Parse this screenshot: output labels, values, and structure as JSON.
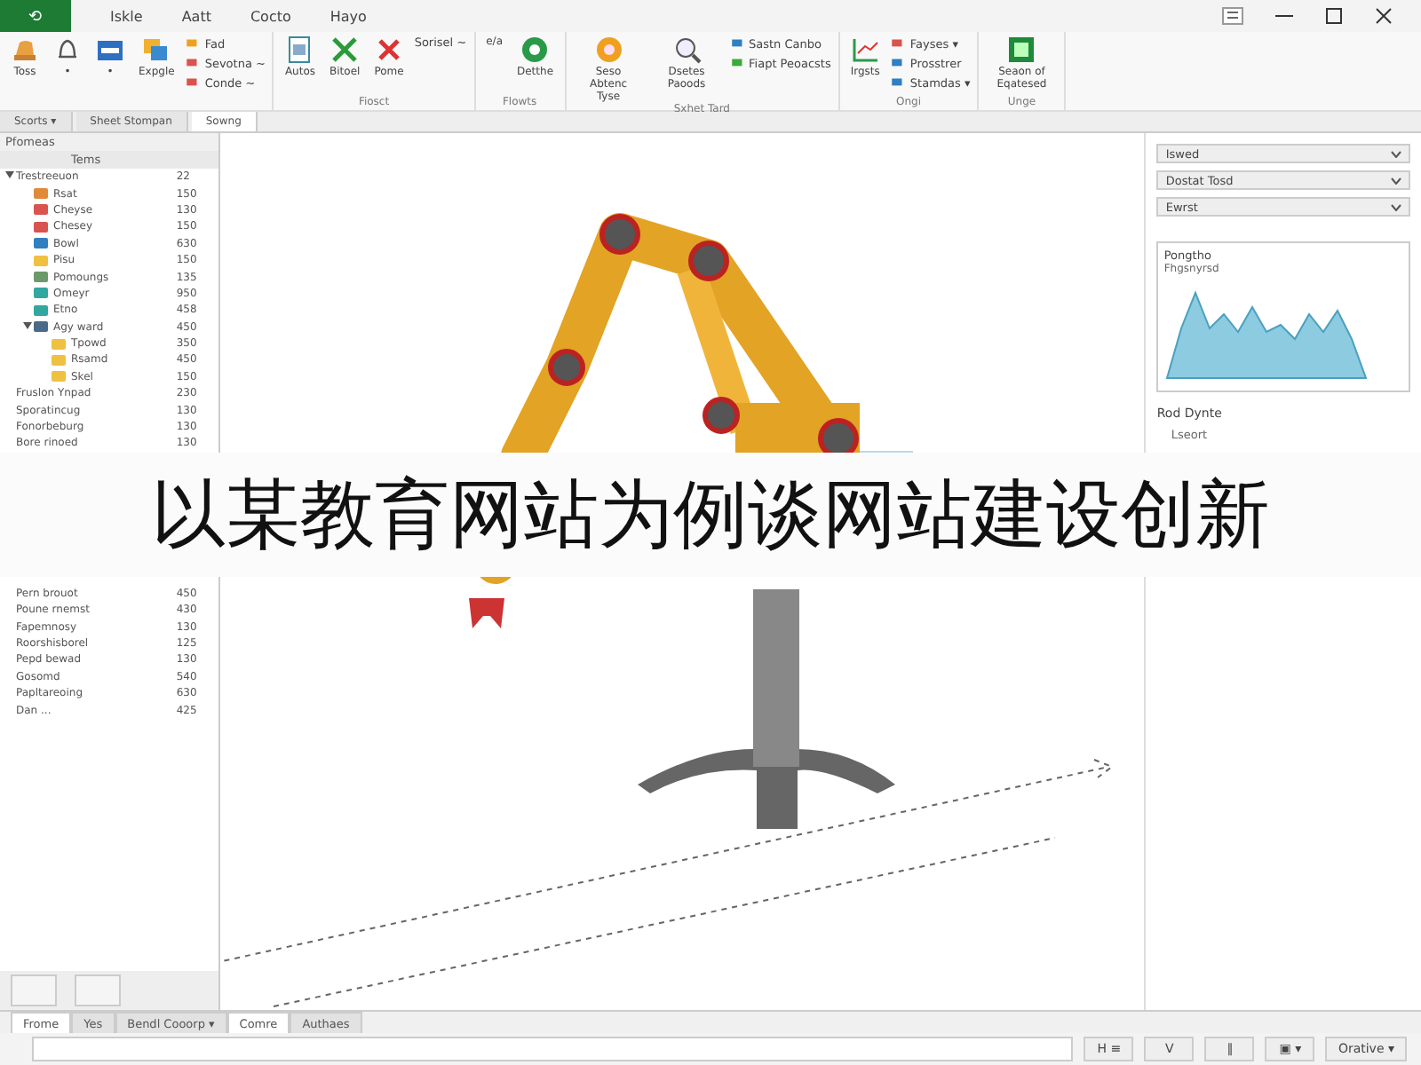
{
  "menu_bar": {
    "file_tab": "⟲",
    "items": [
      "Iskle",
      "Aatt",
      "Cocto",
      "Hayo"
    ]
  },
  "ribbon": {
    "groups": [
      {
        "buttons": [
          {
            "kind": "large",
            "label": "Toss"
          },
          {
            "kind": "large",
            "label": "•"
          },
          {
            "kind": "large",
            "label": "•"
          },
          {
            "kind": "large",
            "label": "Expgle"
          },
          {
            "kind": "stack",
            "items": [
              "Fad",
              "Sevotna ~",
              "Conde ~"
            ]
          }
        ]
      },
      {
        "label": "Fiosct",
        "buttons": [
          {
            "kind": "large",
            "label": "Autos"
          },
          {
            "kind": "large",
            "label": "Bitoel"
          },
          {
            "kind": "large",
            "label": "Pome"
          },
          {
            "kind": "stack",
            "items": [
              "Sorisel ~"
            ]
          }
        ]
      },
      {
        "label": "Flowts",
        "buttons": [
          {
            "kind": "large",
            "label": "e/a"
          },
          {
            "kind": "large",
            "label": "Detthe"
          }
        ]
      },
      {
        "label": "Sxhet Tard",
        "buttons": [
          {
            "kind": "large",
            "label": "Seso Abtenc Tyse"
          },
          {
            "kind": "large",
            "label": "Dsetes Paoods"
          },
          {
            "kind": "stack",
            "items": [
              "Sastn Canbo",
              "Fiapt Peoacsts"
            ]
          }
        ]
      },
      {
        "label": "Ongi",
        "buttons": [
          {
            "kind": "large",
            "label": "Irgsts"
          },
          {
            "kind": "stack",
            "items": [
              "Fayses ▾",
              "Prosstrer",
              "Stamdas ▾"
            ]
          }
        ]
      },
      {
        "label": "Unge",
        "buttons": [
          {
            "kind": "large",
            "label": "Seaon of Eqatesed"
          }
        ]
      }
    ]
  },
  "doc_tabs": [
    {
      "label": "Scorts ▾",
      "selected": false
    },
    {
      "label": "Sheet Stompan",
      "selected": false
    },
    {
      "label": "Sowng",
      "selected": true
    }
  ],
  "left_panel": {
    "title": "Pfomeas",
    "column_1": "Tems",
    "tree": [
      {
        "label": "Trestreeuon",
        "value": "22",
        "expanded": true,
        "children": [
          {
            "label": "Rsat",
            "value": "150",
            "color": "#e08a3a"
          },
          {
            "label": "Cheyse",
            "value": "130",
            "color": "#d9534f"
          },
          {
            "label": "Chesey",
            "value": "150",
            "color": "#d9534f"
          },
          {
            "label": "Bowl",
            "value": "630",
            "color": "#2f7fc1"
          },
          {
            "label": "Pisu",
            "value": "150",
            "color": "#f0c040"
          },
          {
            "label": "Pomoungs",
            "value": "135",
            "color": "#6a9a6a"
          },
          {
            "label": "Omeyr",
            "value": "950",
            "color": "#30a8a0"
          },
          {
            "label": "Etno",
            "value": "458",
            "color": "#30a8a0"
          },
          {
            "label": "Agy ward",
            "value": "450",
            "expanded": true,
            "color": "#4a6a8a",
            "children": [
              {
                "label": "Tpowd",
                "value": "350",
                "color": "#f0c040"
              },
              {
                "label": "Rsamd",
                "value": "450",
                "color": "#f0c040"
              },
              {
                "label": "Skel",
                "value": "150",
                "color": "#f0c040"
              }
            ]
          }
        ]
      },
      {
        "label": "Fruslon Ynpad",
        "value": "230"
      },
      {
        "label": "Sporatincug",
        "value": "130"
      },
      {
        "label": "Fonorbeburg",
        "value": "130"
      },
      {
        "label": "Bore rinoed",
        "value": "130"
      }
    ],
    "tree_below_banner": [
      {
        "label": "Pern brouot",
        "value": "450"
      },
      {
        "label": "Poune rnemst",
        "value": "430"
      },
      {
        "label": "Fapemnosy",
        "value": "130"
      },
      {
        "label": "Roorshisborel",
        "value": "125"
      },
      {
        "label": "Pepd bewad",
        "value": "130"
      },
      {
        "label": "Gosomd",
        "value": "540"
      },
      {
        "label": "Papltareoing",
        "value": "630"
      },
      {
        "label": "Dan ...",
        "value": "425"
      }
    ]
  },
  "right_panel": {
    "dropdowns": [
      "Iswed",
      "Dostat Tosd",
      "Ewrst"
    ],
    "chart": {
      "title": "Pongtho",
      "subtitle": "Fhgsnyrsd"
    },
    "section": "Rod Dynte",
    "subsection": "Lseort"
  },
  "title_banner": "以某教育网站为例谈网站建设创新",
  "bottom_tabs": [
    {
      "label": "Frome",
      "selected": true
    },
    {
      "label": "Yes",
      "selected": false
    },
    {
      "label": "Bendl Cooorp ▾",
      "selected": false
    },
    {
      "label": "Comre",
      "selected": true
    },
    {
      "label": "Authaes",
      "selected": false
    }
  ],
  "status_bar": {
    "buttons": [
      "H ≡",
      "V",
      "‖",
      "▣ ▾",
      "Orative ▾"
    ]
  }
}
